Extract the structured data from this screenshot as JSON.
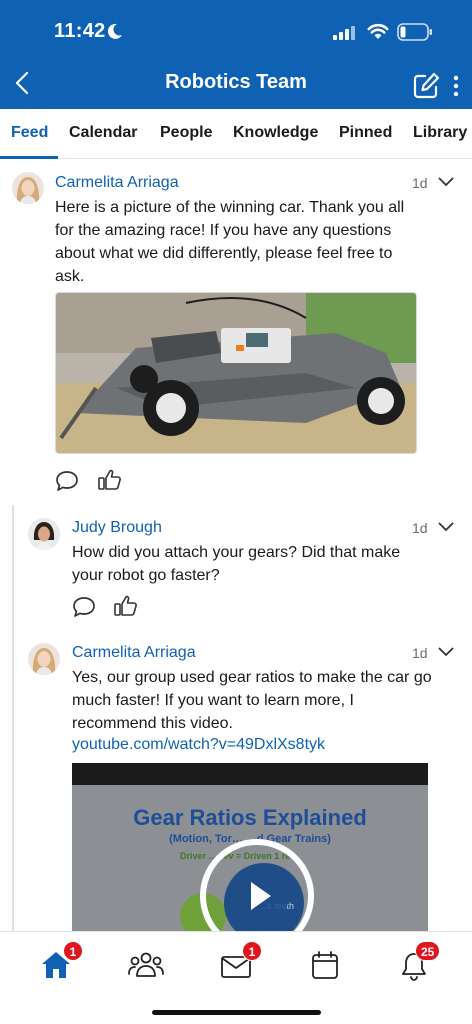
{
  "status_bar": {
    "time": "11:42"
  },
  "header": {
    "title": "Robotics Team"
  },
  "tabs": [
    {
      "label": "Feed"
    },
    {
      "label": "Calendar"
    },
    {
      "label": "People"
    },
    {
      "label": "Knowledge"
    },
    {
      "label": "Pinned"
    },
    {
      "label": "Library"
    }
  ],
  "posts": [
    {
      "author": "Carmelita Arriaga",
      "time": "1d",
      "text": "Here is a picture of the winning car. Thank you all for the amazing race! If you have any questions about what we did differently, please feel free to ask."
    },
    {
      "author": "Judy Brough",
      "time": "1d",
      "text": "How did you attach your gears? Did that make your robot go faster?"
    },
    {
      "author": "Carmelita Arriaga",
      "time": "1d",
      "text": "Yes, our group used gear ratios to make the car go much faster! If you want to learn more, I recommend this video.",
      "link": "youtube.com/watch?v=49DxlXs8tyk"
    }
  ],
  "video": {
    "title": "Gear Ratios Explained",
    "subtitle": "(Motion, Tor… …d Gear Trains)",
    "formula": "Driver … rev = Driven 1 re…",
    "gear_label": "…s teeth"
  },
  "bottom_nav": {
    "items": [
      {
        "name": "home",
        "badge": "1"
      },
      {
        "name": "people",
        "badge": ""
      },
      {
        "name": "mail",
        "badge": "1"
      },
      {
        "name": "calendar",
        "badge": ""
      },
      {
        "name": "notifications",
        "badge": "25"
      }
    ]
  },
  "colors": {
    "brand": "#0f62b3",
    "badge": "#e0161f"
  }
}
